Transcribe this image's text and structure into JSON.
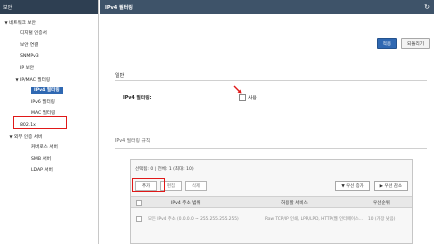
{
  "sidebar": {
    "header": "보안",
    "items": [
      {
        "label": "네트워크 보안",
        "expander": "▼"
      },
      {
        "label": "디지털 인증서"
      },
      {
        "label": "보안 연결"
      },
      {
        "label": "SNMPv3"
      },
      {
        "label": "IP 보안"
      },
      {
        "label": "IP/MAC 필터링",
        "expander": "▼"
      },
      {
        "label": "IPv4 필터링"
      },
      {
        "label": "IPv6 필터링"
      },
      {
        "label": "MAC 필터링"
      },
      {
        "label": "802.1x"
      },
      {
        "label": "외부 인증 서버",
        "expander": "▼"
      },
      {
        "label": "커버로스 서버"
      },
      {
        "label": "SMB 서버"
      },
      {
        "label": "LDAP 서버"
      }
    ]
  },
  "main": {
    "title": "IPv4 필터링",
    "refresh_icon": "↻",
    "toolbar": {
      "apply_label": "적용",
      "cancel_label": "되돌리기"
    },
    "general_section": "일반",
    "filter_label": "IPv4 필터링:",
    "enable_label": "사용",
    "rules_section": "IPv4 필터링 규칙",
    "selection_info": "선택됨: 0  |  전체: 1 (최대: 10)",
    "buttons": {
      "add": "추가",
      "edit": "편집",
      "delete": "삭제"
    },
    "order_buttons": {
      "up": "▼ 우선 증가",
      "down": "▶ 우선 감소"
    },
    "table": {
      "columns": [
        "IPv4 주소 범위",
        "허용할 서비스",
        "우선순위"
      ],
      "rows": [
        {
          "range": "모든 IPv4 주소 (0.0.0.0 ~ 255.255.255.255)",
          "services": "Raw TCP/IP 인쇄, LPR/LPD, HTTP(웹 인터페이스...",
          "priority": "10 (가장 낮음)"
        }
      ]
    }
  },
  "colors": {
    "accent": "#2f68b2",
    "header": "#3e5369",
    "highlight_box": "#e01818"
  }
}
